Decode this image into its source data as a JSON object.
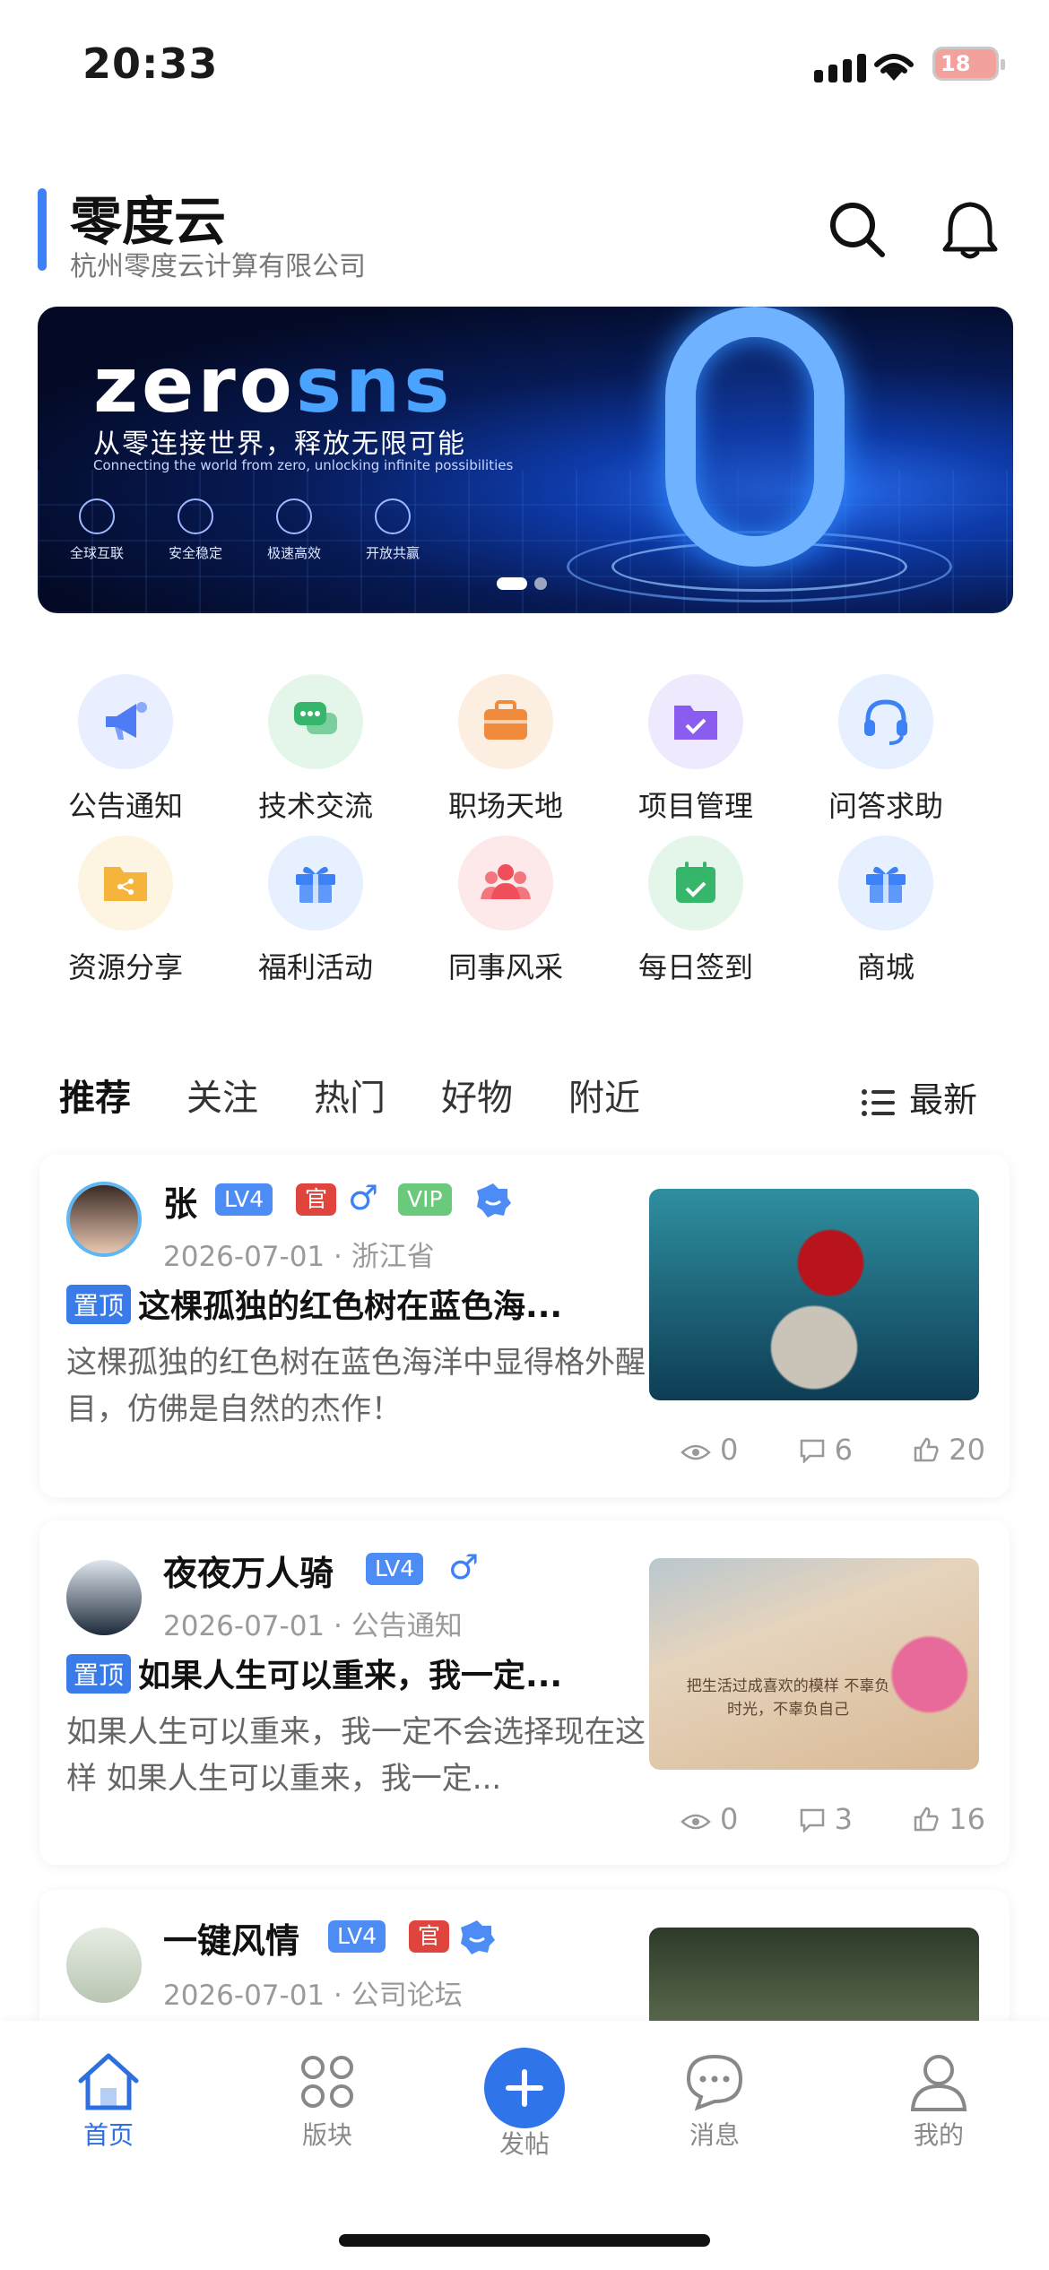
{
  "status": {
    "time": "20:33",
    "battery": "18"
  },
  "header": {
    "title": "零度云",
    "subtitle": "杭州零度云计算有限公司"
  },
  "banner": {
    "logo_a": "zero",
    "logo_b": "sns",
    "slogan": "从零连接世界，释放无限可能",
    "tagline": "Connecting the world from zero, unlocking infinite possibilities",
    "features": [
      "全球互联",
      "安全稳定",
      "极速高效",
      "开放共赢"
    ],
    "big_char": "0"
  },
  "menu": [
    {
      "label": "公告通知",
      "icon": "megaphone-icon",
      "color": "#4d7cf5",
      "bg": "#e9efff"
    },
    {
      "label": "技术交流",
      "icon": "chat-icon",
      "color": "#35b66a",
      "bg": "#e4f6ea"
    },
    {
      "label": "职场天地",
      "icon": "briefcase-icon",
      "color": "#f08a3c",
      "bg": "#fdeee2"
    },
    {
      "label": "项目管理",
      "icon": "folder-check-icon",
      "color": "#8a5cf0",
      "bg": "#efe9fd"
    },
    {
      "label": "问答求助",
      "icon": "headset-icon",
      "color": "#3c82f6",
      "bg": "#e6f0ff"
    },
    {
      "label": "资源分享",
      "icon": "share-folder-icon",
      "color": "#f5b53c",
      "bg": "#fdf4e1"
    },
    {
      "label": "福利活动",
      "icon": "gift-icon",
      "color": "#3c82f6",
      "bg": "#e6f0ff"
    },
    {
      "label": "同事风采",
      "icon": "people-icon",
      "color": "#ef4f5a",
      "bg": "#fde8ea"
    },
    {
      "label": "每日签到",
      "icon": "calendar-check-icon",
      "color": "#35b66a",
      "bg": "#e4f6ea"
    },
    {
      "label": "商城",
      "icon": "gift-shop-icon",
      "color": "#3c82f6",
      "bg": "#e6f0ff"
    }
  ],
  "tabs": [
    "推荐",
    "关注",
    "热门",
    "好物",
    "附近"
  ],
  "sort_label": "最新",
  "posts": [
    {
      "author": "张",
      "level": "LV4",
      "official": "官",
      "gender": "♂",
      "vip": "VIP",
      "date": "2026-07-01",
      "location": "浙江省",
      "pin": "置顶",
      "title": "这棵孤独的红色树在蓝色海...",
      "desc": "这棵孤独的红色树在蓝色海洋中显得格外醒目，仿佛是自然的杰作！",
      "views": "0",
      "comments": "6",
      "likes": "20"
    },
    {
      "author": "夜夜万人骑",
      "level": "LV4",
      "gender": "♂",
      "date": "2026-07-01",
      "location": "公告通知",
      "pin": "置顶",
      "title": "如果人生可以重来，我一定...",
      "desc": "如果人生可以重来，我一定不会选择现在这样 如果人生可以重来，我一定...",
      "views": "0",
      "comments": "3",
      "likes": "16",
      "thumb_text": "把生活过成喜欢的模样 不辜负时光，不辜负自己"
    },
    {
      "author": "一键风情",
      "level": "LV4",
      "official": "官",
      "date": "2026-07-01",
      "location": "公司论坛"
    }
  ],
  "bottom_nav": [
    {
      "label": "首页",
      "icon": "home-icon",
      "active": true
    },
    {
      "label": "版块",
      "icon": "grid-icon"
    },
    {
      "label": "发帖",
      "icon": "plus-icon"
    },
    {
      "label": "消息",
      "icon": "message-icon"
    },
    {
      "label": "我的",
      "icon": "user-icon"
    }
  ]
}
